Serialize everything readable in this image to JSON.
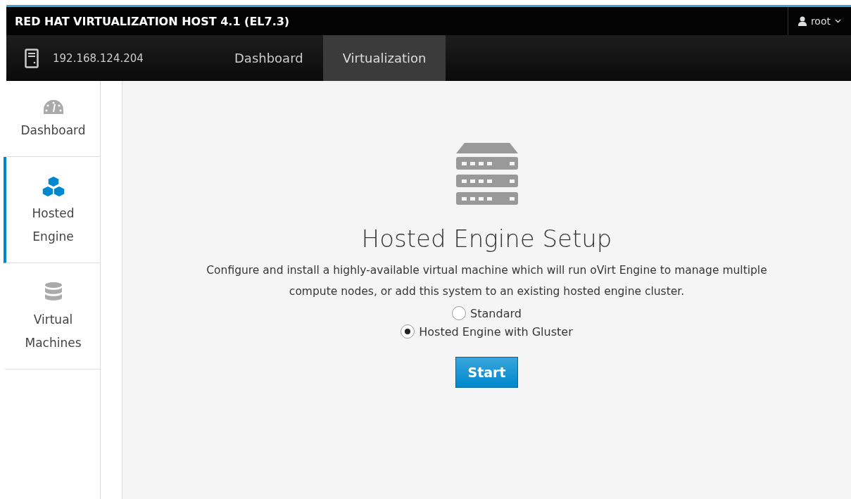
{
  "header": {
    "title": "RED HAT VIRTUALIZATION HOST 4.1 (EL7.3)",
    "user": "root"
  },
  "nav": {
    "host": "192.168.124.204",
    "tabs": [
      {
        "label": "Dashboard",
        "selected": false
      },
      {
        "label": "Virtualization",
        "selected": true
      }
    ]
  },
  "sidebar": {
    "items": [
      {
        "kind": "dashboard",
        "label": "Dashboard",
        "selected": false
      },
      {
        "kind": "hosted-engine",
        "label": "Hosted Engine",
        "selected": true
      },
      {
        "kind": "vms",
        "label": "Virtual Machines",
        "selected": false
      }
    ]
  },
  "setup": {
    "title": "Hosted Engine Setup",
    "description": "Configure and install a highly-available virtual machine which will run oVirt Engine to manage multiple compute nodes, or add this system to an existing hosted engine cluster.",
    "options": [
      {
        "label": "Standard",
        "selected": false
      },
      {
        "label": "Hosted Engine with Gluster",
        "selected": true
      }
    ],
    "button": "Start"
  }
}
